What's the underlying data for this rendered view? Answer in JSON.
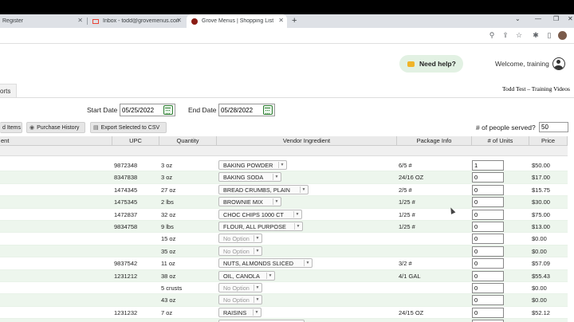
{
  "browser": {
    "tabs": [
      {
        "title": "Register",
        "active": false
      },
      {
        "title": "Inbox - todd@grovemenus.com",
        "active": false
      },
      {
        "title": "Grove Menus | Shopping List",
        "active": true
      }
    ],
    "new_tab": "+",
    "win_controls": [
      "⌄",
      "—",
      "❐",
      "✕"
    ],
    "toolbar_icons": [
      "zoom-icon",
      "share-icon",
      "star-icon",
      "extensions-icon",
      "sidebar-icon",
      "profile-avatar"
    ]
  },
  "header": {
    "need_help": "Need help?",
    "welcome": "Welcome, training",
    "subhead": "Todd Test – Training Videos",
    "nav_tab": "orts"
  },
  "filters": {
    "start_date_label": "Start Date",
    "start_date": "05/25/2022",
    "end_date_label": "End Date",
    "end_date": "05/28/2022"
  },
  "actions": {
    "add_items": "d Items",
    "purchase_history": "Purchase History",
    "export_csv": "Export Selected to CSV",
    "people_label": "# of people served?",
    "people_value": "50"
  },
  "table": {
    "headers": [
      "ent",
      "UPC",
      "Quantity",
      "Vendor Ingredient",
      "Package Info",
      "# of Units",
      "Price"
    ],
    "rows": [
      {
        "upc": "9872348",
        "qty": "3 oz",
        "vendor": "BAKING POWDER",
        "pkg": "6/5 #",
        "units": "1",
        "price": "$50.00",
        "disabled": false
      },
      {
        "upc": "8347838",
        "qty": "3 oz",
        "vendor": "BAKING SODA",
        "pkg": "24/16 OZ",
        "units": "0",
        "price": "$17.00",
        "disabled": false
      },
      {
        "upc": "1474345",
        "qty": "27 oz",
        "vendor": "BREAD CRUMBS, PLAIN",
        "pkg": "2/5 #",
        "units": "0",
        "price": "$15.75",
        "disabled": false
      },
      {
        "upc": "1475345",
        "qty": "2 lbs",
        "vendor": "BROWNIE MIX",
        "pkg": "1/25 #",
        "units": "0",
        "price": "$30.00",
        "disabled": false
      },
      {
        "upc": "1472837",
        "qty": "32 oz",
        "vendor": "CHOC CHIPS 1000 CT",
        "pkg": "1/25 #",
        "units": "0",
        "price": "$75.00",
        "disabled": false
      },
      {
        "upc": "9834758",
        "qty": "9 lbs",
        "vendor": "FLOUR, ALL PURPOSE",
        "pkg": "1/25 #",
        "units": "0",
        "price": "$13.00",
        "disabled": false
      },
      {
        "upc": "",
        "qty": "15 oz",
        "vendor": "No Option",
        "pkg": "",
        "units": "0",
        "price": "$0.00",
        "disabled": true
      },
      {
        "upc": "",
        "qty": "35 oz",
        "vendor": "No Option",
        "pkg": "",
        "units": "0",
        "price": "$0.00",
        "disabled": true
      },
      {
        "upc": "9837542",
        "qty": "11 oz",
        "vendor": "NUTS, ALMONDS SLICED",
        "pkg": "3/2 #",
        "units": "0",
        "price": "$57.09",
        "disabled": false
      },
      {
        "upc": "1231212",
        "qty": "38 oz",
        "vendor": "OIL, CANOLA",
        "pkg": "4/1 GAL",
        "units": "0",
        "price": "$55.43",
        "disabled": false
      },
      {
        "upc": "",
        "qty": "5 crusts",
        "vendor": "No Option",
        "pkg": "",
        "units": "0",
        "price": "$0.00",
        "disabled": true
      },
      {
        "upc": "",
        "qty": "43 oz",
        "vendor": "No Option",
        "pkg": "",
        "units": "0",
        "price": "$0.00",
        "disabled": true
      },
      {
        "upc": "1231232",
        "qty": "7 oz",
        "vendor": "RAISINS",
        "pkg": "24/15 OZ",
        "units": "0",
        "price": "$52.12",
        "disabled": false
      }
    ]
  }
}
